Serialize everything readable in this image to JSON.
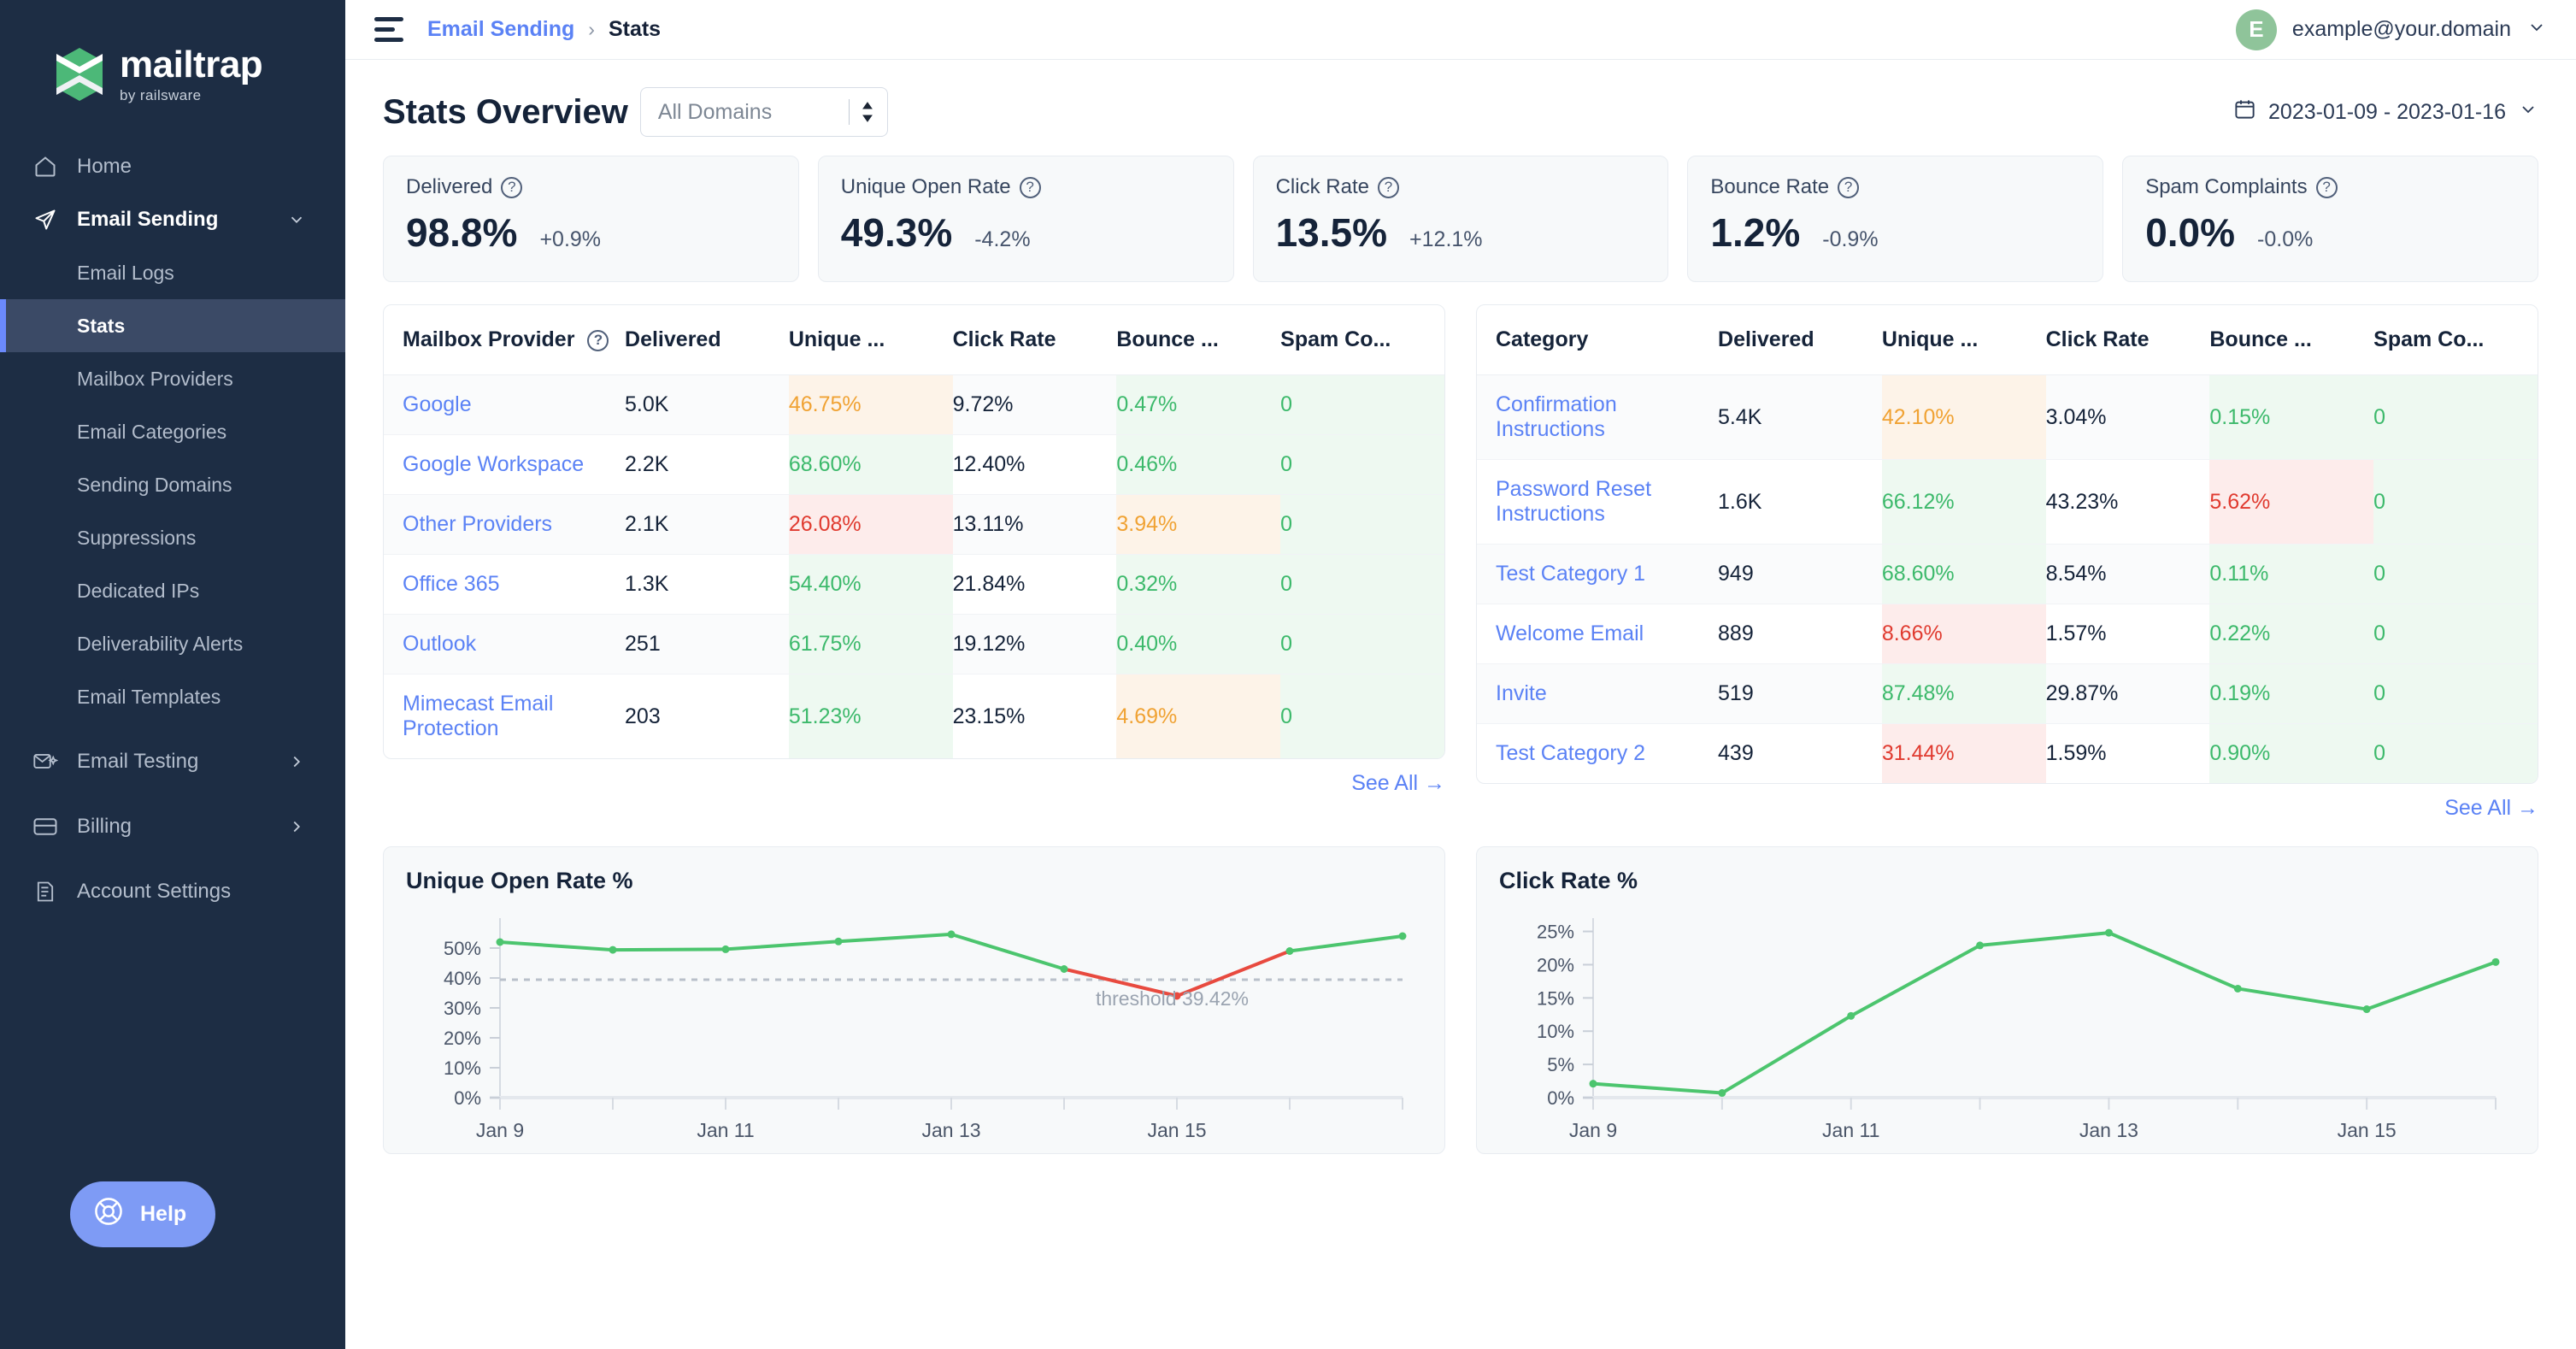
{
  "brand": {
    "name": "mailtrap",
    "tagline": "by railsware",
    "logo_green": "#4cb878"
  },
  "sidebar": {
    "home_label": "Home",
    "email_sending_label": "Email Sending",
    "sub_items": [
      {
        "label": "Email Logs",
        "selected": false
      },
      {
        "label": "Stats",
        "selected": true
      },
      {
        "label": "Mailbox Providers",
        "selected": false
      },
      {
        "label": "Email Categories",
        "selected": false
      },
      {
        "label": "Sending Domains",
        "selected": false
      },
      {
        "label": "Suppressions",
        "selected": false
      },
      {
        "label": "Dedicated IPs",
        "selected": false
      },
      {
        "label": "Deliverability Alerts",
        "selected": false
      },
      {
        "label": "Email Templates",
        "selected": false
      }
    ],
    "email_testing_label": "Email Testing",
    "billing_label": "Billing",
    "account_settings_label": "Account Settings",
    "help_label": "Help"
  },
  "topbar": {
    "breadcrumb_parent": "Email Sending",
    "breadcrumb_separator": "›",
    "breadcrumb_current": "Stats",
    "avatar_initial": "E",
    "user_email": "example@your.domain"
  },
  "page": {
    "title": "Stats Overview",
    "domain_filter_value": "All Domains",
    "date_range": "2023-01-09 - 2023-01-16"
  },
  "kpis": [
    {
      "label": "Delivered",
      "value": "98.8%",
      "delta": "+0.9%"
    },
    {
      "label": "Unique Open Rate",
      "value": "49.3%",
      "delta": "-4.2%"
    },
    {
      "label": "Click Rate",
      "value": "13.5%",
      "delta": "+12.1%"
    },
    {
      "label": "Bounce Rate",
      "value": "1.2%",
      "delta": "-0.9%"
    },
    {
      "label": "Spam Complaints",
      "value": "0.0%",
      "delta": "-0.0%"
    }
  ],
  "provider_table": {
    "headers": [
      "Mailbox Provider",
      "Delivered",
      "Unique ...",
      "Click Rate",
      "Bounce ...",
      "Spam Co..."
    ],
    "rows": [
      {
        "name": "Google",
        "delivered": "5.0K",
        "unique_open": "46.75%",
        "open_tone": "orange",
        "click": "9.72%",
        "bounce": "0.47%",
        "bounce_tone": "green",
        "spam": "0"
      },
      {
        "name": "Google Workspace",
        "delivered": "2.2K",
        "unique_open": "68.60%",
        "open_tone": "green",
        "click": "12.40%",
        "bounce": "0.46%",
        "bounce_tone": "green",
        "spam": "0"
      },
      {
        "name": "Other Providers",
        "delivered": "2.1K",
        "unique_open": "26.08%",
        "open_tone": "red",
        "click": "13.11%",
        "bounce": "3.94%",
        "bounce_tone": "orange",
        "spam": "0"
      },
      {
        "name": "Office 365",
        "delivered": "1.3K",
        "unique_open": "54.40%",
        "open_tone": "green",
        "click": "21.84%",
        "bounce": "0.32%",
        "bounce_tone": "green",
        "spam": "0"
      },
      {
        "name": "Outlook",
        "delivered": "251",
        "unique_open": "61.75%",
        "open_tone": "green",
        "click": "19.12%",
        "bounce": "0.40%",
        "bounce_tone": "green",
        "spam": "0"
      },
      {
        "name": "Mimecast Email Protection",
        "delivered": "203",
        "unique_open": "51.23%",
        "open_tone": "green",
        "click": "23.15%",
        "bounce": "4.69%",
        "bounce_tone": "orange",
        "spam": "0"
      }
    ],
    "see_all": "See All →"
  },
  "category_table": {
    "headers": [
      "Category",
      "Delivered",
      "Unique ...",
      "Click Rate",
      "Bounce ...",
      "Spam Co..."
    ],
    "rows": [
      {
        "name": "Confirmation Instructions",
        "delivered": "5.4K",
        "unique_open": "42.10%",
        "open_tone": "orange",
        "click": "3.04%",
        "bounce": "0.15%",
        "bounce_tone": "green",
        "spam": "0"
      },
      {
        "name": "Password Reset Instructions",
        "delivered": "1.6K",
        "unique_open": "66.12%",
        "open_tone": "green",
        "click": "43.23%",
        "bounce": "5.62%",
        "bounce_tone": "red",
        "spam": "0"
      },
      {
        "name": "Test Category 1",
        "delivered": "949",
        "unique_open": "68.60%",
        "open_tone": "green",
        "click": "8.54%",
        "bounce": "0.11%",
        "bounce_tone": "green",
        "spam": "0"
      },
      {
        "name": "Welcome Email",
        "delivered": "889",
        "unique_open": "8.66%",
        "open_tone": "red",
        "click": "1.57%",
        "bounce": "0.22%",
        "bounce_tone": "green",
        "spam": "0"
      },
      {
        "name": "Invite",
        "delivered": "519",
        "unique_open": "87.48%",
        "open_tone": "green",
        "click": "29.87%",
        "bounce": "0.19%",
        "bounce_tone": "green",
        "spam": "0"
      },
      {
        "name": "Test Category 2",
        "delivered": "439",
        "unique_open": "31.44%",
        "open_tone": "red",
        "click": "1.59%",
        "bounce": "0.90%",
        "bounce_tone": "green",
        "spam": "0"
      }
    ],
    "see_all": "See All →"
  },
  "chart_data": [
    {
      "type": "line",
      "id": "unique-open-rate",
      "title": "Unique Open Rate %",
      "xlabel": "",
      "ylabel": "",
      "ylim": [
        0,
        60
      ],
      "yticks": [
        "0%",
        "10%",
        "20%",
        "30%",
        "40%",
        "50%"
      ],
      "ytick_values": [
        0,
        10,
        20,
        30,
        40,
        50
      ],
      "xtick_labels": [
        "Jan 9",
        "Jan 11",
        "Jan 13",
        "Jan 15"
      ],
      "x": [
        "Jan 9",
        "Jan 9.5",
        "Jan 10",
        "Jan 10.5",
        "Jan 11",
        "Jan 11.5",
        "Jan 12",
        "Jan 12.5",
        "Jan 13",
        "Jan 13.5",
        "Jan 14",
        "Jan 14.5",
        "Jan 15",
        "Jan 15.5",
        "Jan 16"
      ],
      "values": [
        52.0,
        49.4,
        49.6,
        52.2,
        54.6,
        43.0,
        34.0,
        49.0,
        54.0
      ],
      "x_points": [
        "Jan 9",
        "Jan 9.9",
        "Jan 10.9",
        "Jan 11.8",
        "Jan 12.7",
        "Jan 13.6",
        "Jan 14.6",
        "Jan 15.5",
        "Jan 16"
      ],
      "grid": false,
      "legend": "none",
      "line_color": "#4cc56e",
      "alert_color": "#e84a3f",
      "threshold_value": 39.42,
      "threshold_label": "threshold 39.42%"
    },
    {
      "type": "line",
      "id": "click-rate",
      "title": "Click Rate %",
      "xlabel": "",
      "ylabel": "",
      "ylim": [
        0,
        27
      ],
      "yticks": [
        "0%",
        "5%",
        "10%",
        "15%",
        "20%",
        "25%"
      ],
      "ytick_values": [
        0,
        5,
        10,
        15,
        20,
        25
      ],
      "xtick_labels": [
        "Jan 9",
        "Jan 11",
        "Jan 13",
        "Jan 15"
      ],
      "values": [
        2.1,
        0.7,
        12.3,
        22.9,
        24.8,
        16.4,
        13.3,
        20.4
      ],
      "x_points": [
        "Jan 9",
        "Jan 9.9",
        "Jan 10.9",
        "Jan 11.8",
        "Jan 12.7",
        "Jan 13.6",
        "Jan 14.6",
        "Jan 16"
      ],
      "grid": false,
      "legend": "none",
      "line_color": "#4cc56e"
    }
  ]
}
